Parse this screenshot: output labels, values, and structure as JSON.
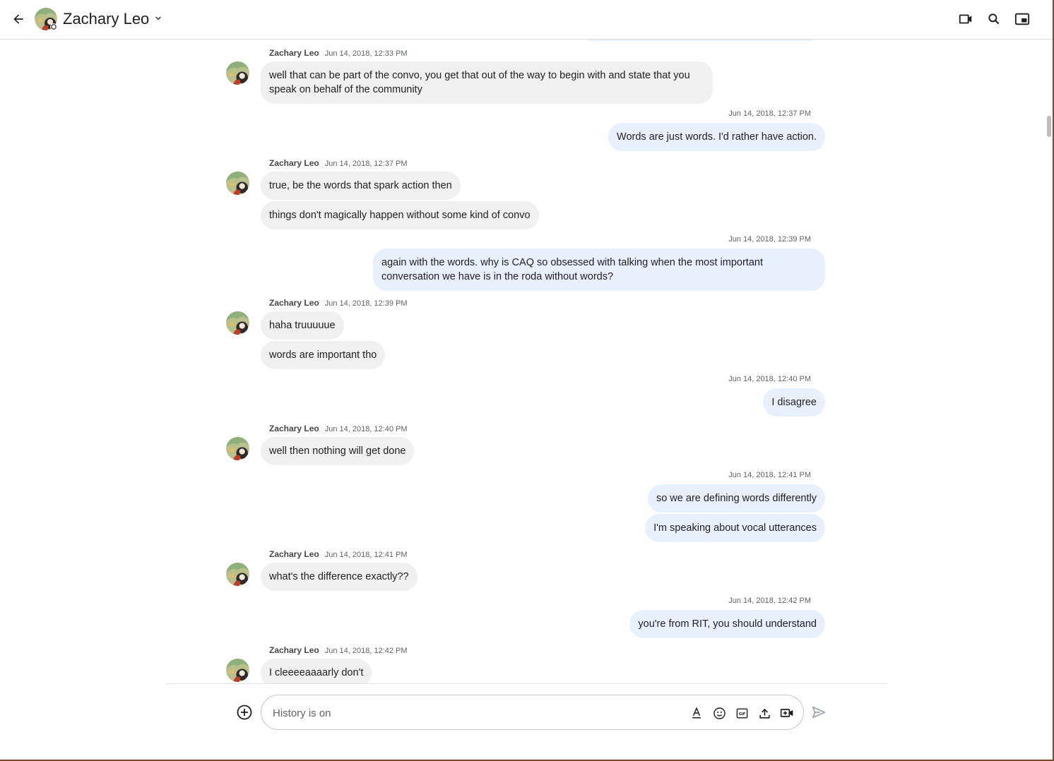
{
  "header": {
    "contact_name": "Zachary Leo",
    "back_icon": "arrow-back-icon",
    "chevron_icon": "chevron-down-icon",
    "actions": [
      "video-call-icon",
      "search-icon",
      "picture-in-picture-icon"
    ]
  },
  "messages": {
    "m1": {
      "sender": "Zachary Leo",
      "time": "Jun 14, 2018, 12:33 PM",
      "text": "well that can be part of the convo, you get that out of the way to begin with and state that you speak on behalf of the community"
    },
    "m2": {
      "time": "Jun 14, 2018, 12:37 PM",
      "text": "Words are just words.  I'd rather have action."
    },
    "m3": {
      "sender": "Zachary Leo",
      "time": "Jun 14, 2018, 12:37 PM",
      "text1": "true, be the words that spark action then",
      "text2": "things don't magically happen without some kind of convo"
    },
    "m4": {
      "time": "Jun 14, 2018, 12:39 PM",
      "text": "again with the words.  why is CAQ so obsessed with talking when the most important conversation we have is in the roda without words?"
    },
    "m5": {
      "sender": "Zachary Leo",
      "time": "Jun 14, 2018, 12:39 PM",
      "text1": "haha truuuuue",
      "text2": "words are important tho"
    },
    "m6": {
      "time": "Jun 14, 2018, 12:40 PM",
      "text": "I disagree"
    },
    "m7": {
      "sender": "Zachary Leo",
      "time": "Jun 14, 2018, 12:40 PM",
      "text": "well then nothing will get done"
    },
    "m8": {
      "time": "Jun 14, 2018, 12:41 PM",
      "text1": "so we are defining words differently",
      "text2": "I'm speaking about vocal utterances"
    },
    "m9": {
      "sender": "Zachary Leo",
      "time": "Jun 14, 2018, 12:41 PM",
      "text": "what's the difference exactly??"
    },
    "m10": {
      "time": "Jun 14, 2018, 12:42 PM",
      "text": "you're from RIT, you should understand"
    },
    "m11": {
      "sender": "Zachary Leo",
      "time": "Jun 14, 2018, 12:42 PM",
      "text": "I cleeeeaaaarly don't"
    }
  },
  "composer": {
    "placeholder": "History is on",
    "tools": [
      "format-text-icon",
      "emoji-icon",
      "gif-icon",
      "upload-icon",
      "video-meeting-icon"
    ],
    "add_icon": "add-circle-icon",
    "send_icon": "send-icon"
  },
  "colors": {
    "incoming_bubble": "#f0f0f0",
    "outgoing_bubble": "#e8effd",
    "frame": "#7a4a2a"
  }
}
